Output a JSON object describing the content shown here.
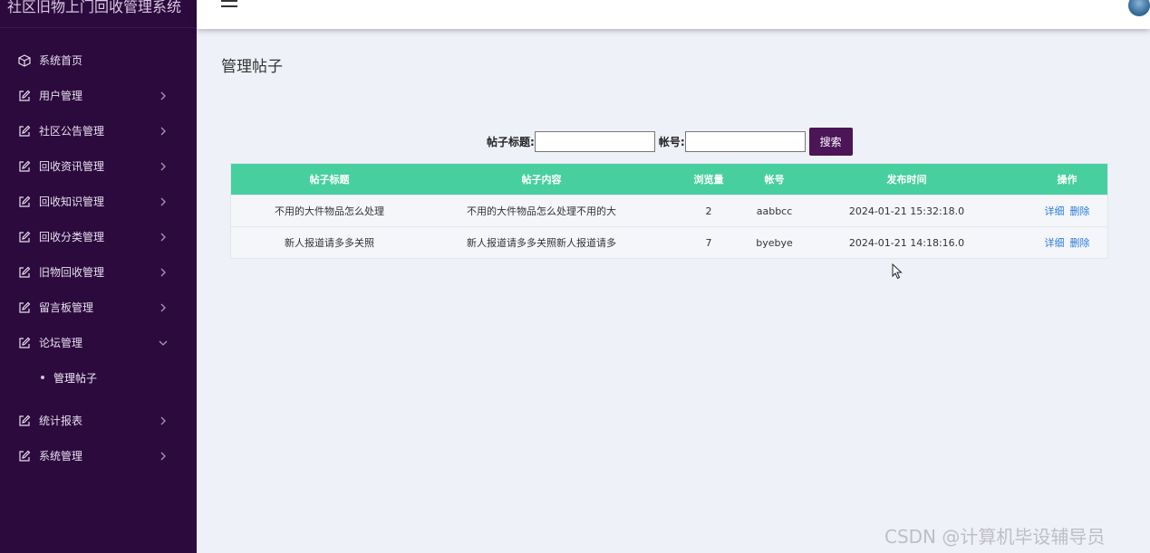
{
  "app": {
    "title": "社区旧物上门回收管理系统"
  },
  "sidebar": {
    "items": [
      {
        "label": "系统首页",
        "icon": "cube-icon"
      },
      {
        "label": "用户管理",
        "icon": "edit-icon"
      },
      {
        "label": "社区公告管理",
        "icon": "edit-icon"
      },
      {
        "label": "回收资讯管理",
        "icon": "edit-icon"
      },
      {
        "label": "回收知识管理",
        "icon": "edit-icon"
      },
      {
        "label": "回收分类管理",
        "icon": "edit-icon"
      },
      {
        "label": "旧物回收管理",
        "icon": "edit-icon"
      },
      {
        "label": "留言板管理",
        "icon": "edit-icon"
      },
      {
        "label": "论坛管理",
        "icon": "edit-icon"
      },
      {
        "label": "统计报表",
        "icon": "edit-icon"
      },
      {
        "label": "系统管理",
        "icon": "edit-icon"
      }
    ],
    "subitems": [
      {
        "label": "管理帖子"
      }
    ]
  },
  "page": {
    "title": "管理帖子"
  },
  "search": {
    "title_label": "帖子标题:",
    "title_value": "",
    "account_label": "帐号:",
    "account_value": "",
    "button": "搜索"
  },
  "table": {
    "headers": [
      "帖子标题",
      "帖子内容",
      "浏览量",
      "帐号",
      "发布时间",
      "操作"
    ],
    "rows": [
      {
        "title": "不用的大件物品怎么处理",
        "content": "不用的大件物品怎么处理不用的大",
        "views": "2",
        "account": "aabbcc",
        "time": "2024-01-21 15:32:18.0",
        "detail": "详细",
        "delete": "删除"
      },
      {
        "title": "新人报道请多多关照",
        "content": "新人报道请多多关照新人报道请多",
        "views": "7",
        "account": "byebye",
        "time": "2024-01-21 14:18:16.0",
        "detail": "详细",
        "delete": "删除"
      }
    ]
  },
  "watermark": "CSDN @计算机毕设辅导员",
  "colors": {
    "sidebar_bg": "#2c0a3e",
    "table_header": "#47cfa0",
    "search_button": "#4b1558",
    "link": "#2b7bd9",
    "page_bg": "#eff1f8"
  }
}
